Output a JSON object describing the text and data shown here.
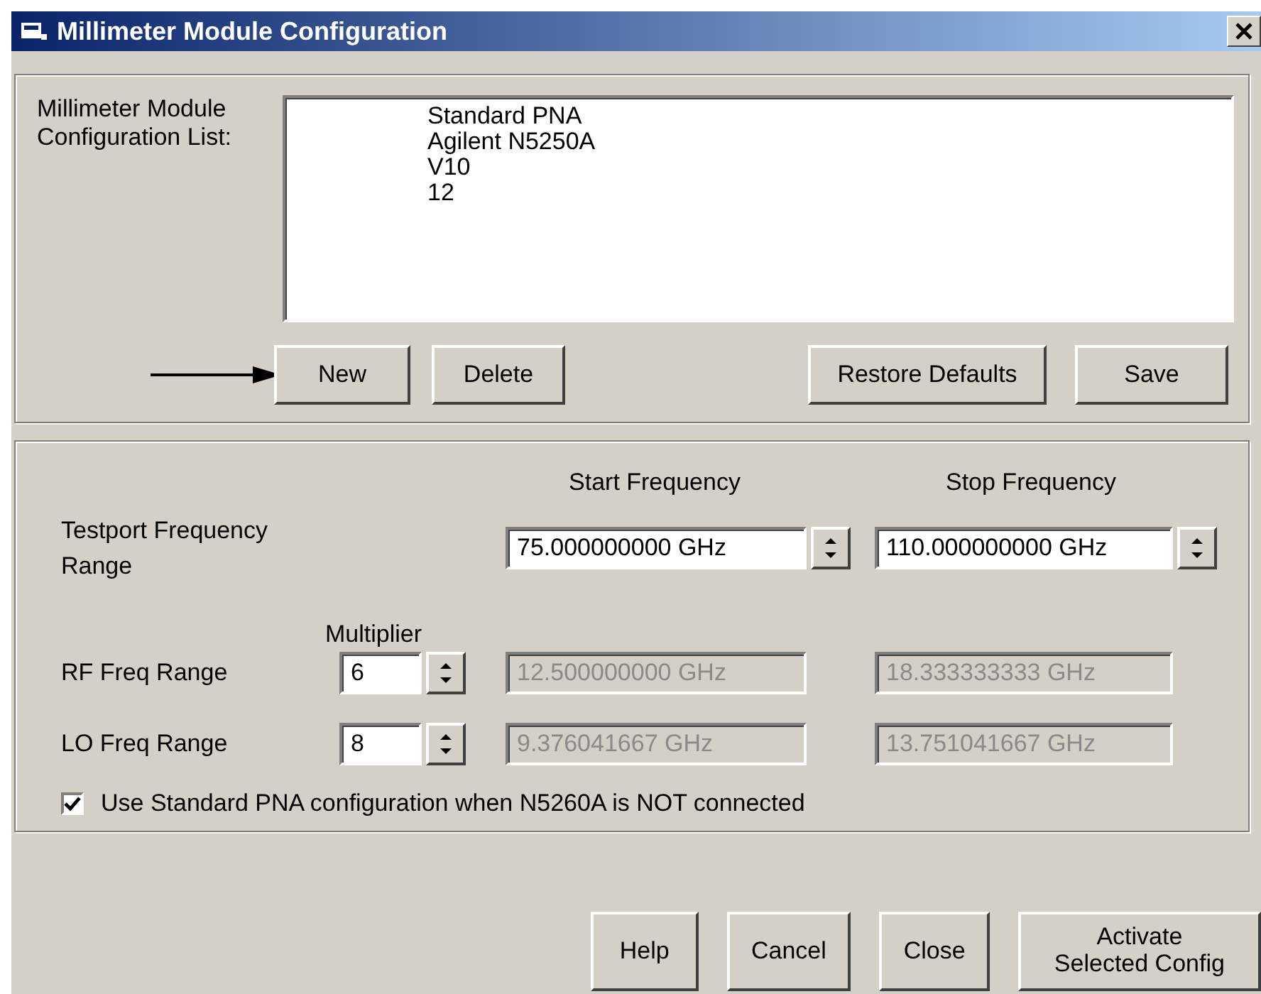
{
  "window": {
    "title": "Millimeter Module Configuration"
  },
  "config_list": {
    "label": "Millimeter Module Configuration List:",
    "items": [
      "Standard PNA",
      "Agilent N5250A",
      "V10",
      "12"
    ],
    "buttons": [
      "New",
      "Delete",
      "Restore Defaults",
      "Save"
    ]
  },
  "frequency": {
    "start_header": "Start Frequency",
    "stop_header": "Stop Frequency",
    "multiplier_header": "Multiplier",
    "rows": [
      {
        "kind": "range",
        "label": "Testport Frequency Range",
        "start": "75.000000000 GHz",
        "stop": "110.000000000 GHz",
        "disabled": false
      },
      {
        "kind": "multiplied",
        "label": "RF Freq Range",
        "multiplier": "6",
        "start": "12.500000000 GHz",
        "stop": "18.333333333 GHz",
        "disabled": true
      },
      {
        "kind": "multiplied",
        "label": "LO Freq Range",
        "multiplier": "8",
        "start": "9.376041667 GHz",
        "stop": "13.751041667 GHz",
        "disabled": true
      }
    ]
  },
  "checkbox": {
    "label": "Use Standard PNA configuration when N5260A is NOT connected",
    "checked": true
  },
  "footer_buttons": [
    "Help",
    "Cancel",
    "Close",
    "Activate\nSelected Config"
  ]
}
